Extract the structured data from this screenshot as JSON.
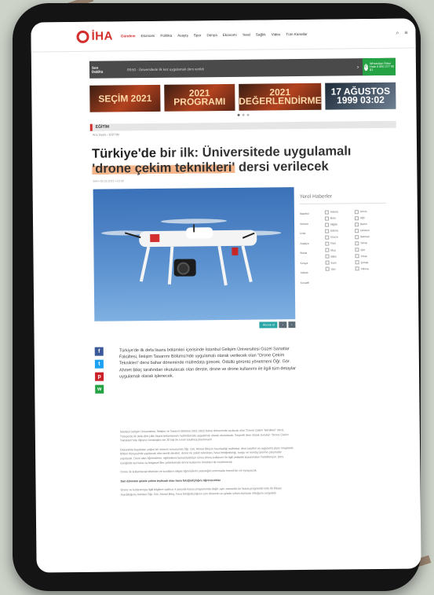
{
  "header": {
    "logo_text": "İHA",
    "nav_items": [
      "Gündem",
      "Ekonomi",
      "Politika",
      "Asayiş",
      "Spor",
      "Dünya",
      "Ekonomi",
      "Yerel",
      "Sağlık",
      "Video",
      "Tüm Kanallar"
    ]
  },
  "news_bar": {
    "label": "Son Dakika",
    "ticker": "09:50 - Üniversitede ilk kez uygulamalı ders verildi",
    "whatsapp": "WhatsApp İhbar Hattı 0 850 277 00 81"
  },
  "banners": [
    "SEÇİM 2021",
    "2021 PROGRAMI",
    "2021 DEĞERLENDİRME",
    "17 AĞUSTOS 1999 03:02"
  ],
  "section": "EĞİTİM",
  "breadcrumb": "Ana Sayfa › EĞİTİM",
  "article": {
    "title_bold": "Türkiye'de",
    "title_rest": " bir ilk: Üniversitede uygulamalı",
    "title_hl": "'drone çekim teknikleri'",
    "title_end": " dersi verilecek",
    "meta": "İHA ▪ 05.03.2021 ▪ 10:30",
    "lead": "Türkiye'de ilk defa lisans bölümleri içerisinde İstanbul Gelişim Üniversitesi Güzel Sanatlar Fakültesi, İletişim Tasarımı Bölümü'nde uygulamalı olarak verilecek olan \"Drone Çekim Teknikleri\" dersi bahar döneminde müfredata girecek. Ödüllü görüntü yönetmeni Öğr. Gör. Ahmet Bikiç tarafından okutulacak olan derste, drone ve drone kullanımı ile ilgili tüm detaylar uygulamalı olarak işlenecek.",
    "paragraphs": [
      "İstanbul Gelişim Üniversitesi, İletişim ve Tasarım Bölümü 2021-2022 bahar döneminde açılacak olan \"Drone Çekim Teknikleri\" dersi, Türkiye'de ilk defa dört yıllık lisans bölümlerinin müfredatında uygulamalı olarak okutulacak. Seçmeli ders olarak sunulan \"Drone Çekim Teknikleri\"nde öğrenci kontenjanı ise 20 kişi ile sınırlı tutulmuş planlanıyor.",
      "Dekanlıkta başlatılan yoğun bir sürecin sonucunda Öğr. Gör. Ahmet Bikiç'in hazırladığı müfredat, ders saatleri ve uygulama planı onaylandı. Bölüm bünyesinde yapılacak olan teorik dersleri, drone ile çekim teknikleri, hava fotoğrafçılığı, kurgu ve montaj üzerine çalışmalar yapılacak. Dersi alan öğrencilerin, eğitimlerini tamamladıktan sonra drone kullanımı ile ilgili yetkinlik kazanmaları hedefleniyor. Ders içeriğinde kurmaca ve belgesel film çekimlerinde drone kullanımı örnekleri de incelenecek.",
      "Drone ile kullanılacak teknikler ve kuralların bilgisi öğrencilerin yeteneğini arttırmada önemli bir rol oynayacak."
    ],
    "subheading": "Son dönemin gözde çekim teçhizatı olan hava fotoğrafçılığını öğreneceklar",
    "last_paragraph": "Drone ve kullanımıyla ilgili bilgilere sadece 4 yarıyılık lisans programında değil, aynı zamanda ön lisans programlarında da ihtiyaç duyulduğunu belirten Öğr. Gör. Ahmet Bikiç, hava fotoğrafçılığının son dönemin en gözde çekim teçhizatı olduğunu vurguladı."
  },
  "actions": [
    "Abone ol",
    "‹",
    "›"
  ],
  "share": [
    "f",
    "t",
    "p",
    "w"
  ],
  "sidebar": {
    "title": "Yerel Haberler",
    "col1": [
      "İstanbul",
      "Ankara",
      "İzmir",
      "Antalya",
      "Bursa",
      "Konya",
      "Adana",
      "Kocaeli"
    ],
    "col2": [
      "Adana",
      "Bolu",
      "Niğde",
      "Edirne",
      "Düzce",
      "Rize",
      "Muş",
      "Bitlis",
      "Kars",
      "Van"
    ],
    "col3": [
      "Artvin",
      "Ağrı",
      "Bartın",
      "Giresun",
      "Batman",
      "Sinop",
      "Siirt",
      "Tokat",
      "Şırnak",
      "Yalova"
    ]
  }
}
